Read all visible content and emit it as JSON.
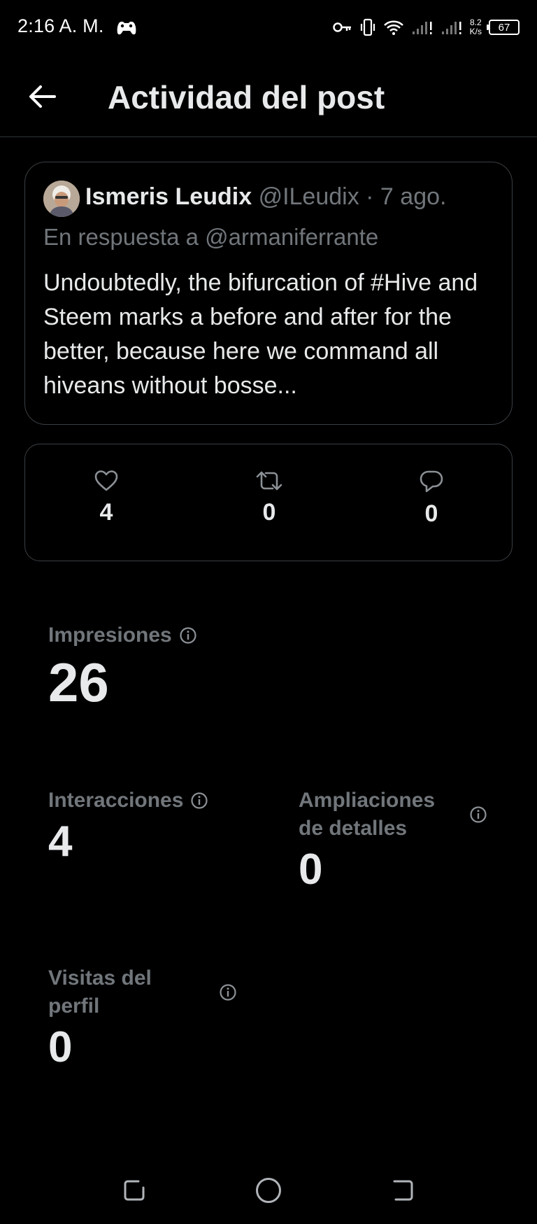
{
  "status_bar": {
    "time": "2:16 A. M.",
    "net_speed_value": "8.2",
    "net_speed_unit": "K/s",
    "battery": "67"
  },
  "header": {
    "title": "Actividad del post"
  },
  "tweet": {
    "author_name": "Ismeris Leudix",
    "author_handle": "@ILeudix · 7 ago.",
    "reply_to": "En respuesta a @armaniferrante",
    "text": "Undoubtedly, the bifurcation of #Hive and Steem marks a before and after for the better, because here we command all hiveans without bosse..."
  },
  "engagement": {
    "likes": "4",
    "reposts": "0",
    "replies": "0"
  },
  "metrics": {
    "impressions_label": "Impresiones",
    "impressions_value": "26",
    "interactions_label": "Interacciones",
    "interactions_value": "4",
    "detail_expands_label_line1": "Ampliaciones",
    "detail_expands_label_line2": "de detalles",
    "detail_expands_value": "0",
    "profile_visits_label_line1": "Visitas del",
    "profile_visits_label_line2": "perfil",
    "profile_visits_value": "0"
  },
  "icons": {
    "back": "arrow-left-icon",
    "game": "gamepad-icon",
    "key": "key-icon",
    "vibrate": "vibrate-icon",
    "wifi": "wifi-icon",
    "signal": "signal-icon",
    "like": "heart-icon",
    "repost": "repost-icon",
    "reply": "reply-bubble-icon",
    "info": "info-icon"
  },
  "colors": {
    "background": "#000000",
    "text_primary": "#e7e9ea",
    "text_secondary": "#71767b",
    "border": "#3a3f43"
  }
}
